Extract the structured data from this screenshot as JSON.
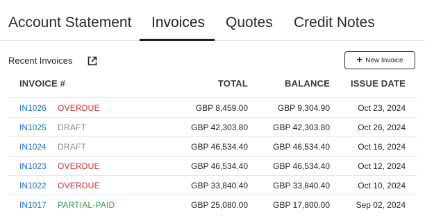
{
  "tabs": [
    {
      "label": "Account Statement",
      "active": false
    },
    {
      "label": "Invoices",
      "active": true
    },
    {
      "label": "Quotes",
      "active": false
    },
    {
      "label": "Credit Notes",
      "active": false
    }
  ],
  "section": {
    "title": "Recent Invoices",
    "new_button_label": "New Invoice"
  },
  "table": {
    "headers": {
      "invoice": "INVOICE #",
      "total": "TOTAL",
      "balance": "BALANCE",
      "issue_date": "ISSUE DATE"
    },
    "rows": [
      {
        "invoice": "IN1026",
        "status": "OVERDUE",
        "total": "GBP 8,459.00",
        "balance": "GBP 9,304.90",
        "issue_date": "Oct 23, 2024"
      },
      {
        "invoice": "IN1025",
        "status": "DRAFT",
        "total": "GBP 42,303.80",
        "balance": "GBP 42,303.80",
        "issue_date": "Oct 26, 2024"
      },
      {
        "invoice": "IN1024",
        "status": "DRAFT",
        "total": "GBP 46,534.40",
        "balance": "GBP 46,534.40",
        "issue_date": "Oct 16, 2024"
      },
      {
        "invoice": "IN1023",
        "status": "OVERDUE",
        "total": "GBP 46,534.40",
        "balance": "GBP 46,534.40",
        "issue_date": "Oct 12, 2024"
      },
      {
        "invoice": "IN1022",
        "status": "OVERDUE",
        "total": "GBP 33,840.40",
        "balance": "GBP 33,840.40",
        "issue_date": "Oct 10, 2024"
      },
      {
        "invoice": "IN1017",
        "status": "PARTIAL-PAID",
        "total": "GBP 25,080.00",
        "balance": "GBP 17,800.00",
        "issue_date": "Sep 02, 2024"
      }
    ]
  },
  "colors": {
    "link": "#1a73c6",
    "overdue": "#d32f2f",
    "draft": "#8a8a8a",
    "partial_paid": "#2e9a4b"
  },
  "icons": {
    "open_external": "external-link-icon",
    "new_invoice": "plus-icon"
  }
}
